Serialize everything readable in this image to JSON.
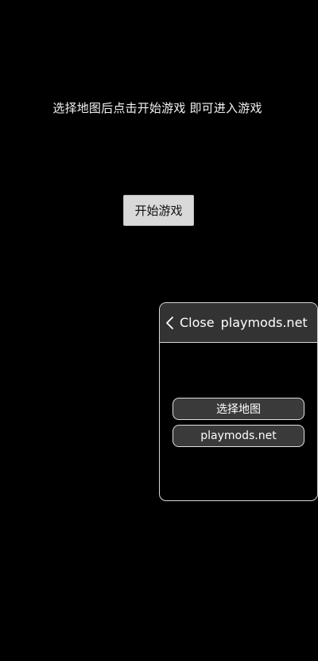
{
  "main": {
    "instruction": "选择地图后点击开始游戏 即可进入游戏",
    "start_button": "开始游戏"
  },
  "mod_menu": {
    "back_icon": "chevron-left-icon",
    "close_label": "Close",
    "site_label": "playmods.net",
    "buttons": [
      {
        "label": "选择地图"
      },
      {
        "label": "playmods.net"
      }
    ]
  },
  "colors": {
    "background": "#000000",
    "start_button_bg": "#d9d9d9",
    "panel_header_bg": "#333333",
    "panel_button_bg": "#3a3a3a",
    "panel_border": "#d8d8d8"
  }
}
